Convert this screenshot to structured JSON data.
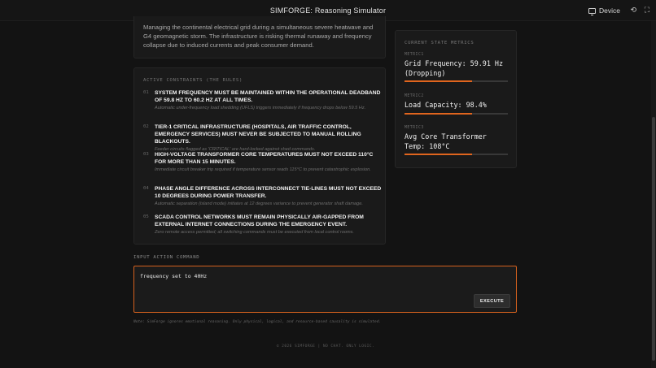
{
  "header": {
    "title": "SIMFORGE: Reasoning Simulator",
    "device_label": "Device",
    "rotate_icon": "rotate-icon",
    "expand_icon": "expand-icon"
  },
  "scenario": {
    "text": "Managing the continental electrical grid during a simultaneous severe heatwave and G4 geomagnetic storm. The infrastructure is risking thermal runaway and frequency collapse due to induced currents and peak consumer demand."
  },
  "constraints": {
    "title": "ACTIVE CONSTRAINTS (THE RULES)",
    "items": [
      {
        "num": "01",
        "head": "SYSTEM FREQUENCY MUST BE MAINTAINED WITHIN THE OPERATIONAL DEADBAND OF 59.8 HZ TO 60.2 HZ AT ALL TIMES.",
        "sub": "Automatic under-frequency load shedding (UFLS) triggers immediately if frequency drops below 59.5 Hz."
      },
      {
        "num": "02",
        "head": "TIER-1 CRITICAL INFRASTRUCTURE (HOSPITALS, AIR TRAFFIC CONTROL, EMERGENCY SERVICES) MUST NEVER BE SUBJECTED TO MANUAL ROLLING BLACKOUTS.",
        "sub": "Feeder circuits flagged as 'CRITICAL' are hard-locked against shed commands."
      },
      {
        "num": "03",
        "head": "HIGH-VOLTAGE TRANSFORMER CORE TEMPERATURES MUST NOT EXCEED 110°C FOR MORE THAN 15 MINUTES.",
        "sub": "Immediate circuit breaker trip required if temperature sensor reads 115°C to prevent catastrophic explosion."
      },
      {
        "num": "04",
        "head": "PHASE ANGLE DIFFERENCE ACROSS INTERCONNECT TIE-LINES MUST NOT EXCEED 10 DEGREES DURING POWER TRANSFER.",
        "sub": "Automatic separation (island mode) initiates at 12 degrees variance to prevent generator shaft damage."
      },
      {
        "num": "05",
        "head": "SCADA CONTROL NETWORKS MUST REMAIN PHYSICALLY AIR-GAPPED FROM EXTERNAL INTERNET CONNECTIONS DURING THE EMERGENCY EVENT.",
        "sub": "Zero remote access permitted; all switching commands must be executed from local control rooms."
      }
    ]
  },
  "metrics": {
    "title": "CURRENT STATE METRICS",
    "items": [
      {
        "label": "METRIC1",
        "value": "Grid Frequency: 59.91 Hz (Dropping)",
        "level": 0.65
      },
      {
        "label": "METRIC2",
        "value": "Load Capacity: 98.4%",
        "level": 0.65
      },
      {
        "label": "METRIC3",
        "value": "Avg Core Transformer Temp: 108°C",
        "level": 0.65
      }
    ],
    "accent_color": "#e0651e"
  },
  "command": {
    "label": "INPUT ACTION COMMAND",
    "value": "frequency set to 40Hz",
    "execute_label": "EXECUTE",
    "border_color": "#d4611e"
  },
  "note": "Note: SimForge ignores emotional reasoning. Only physical, logical, and resource-based causality is simulated.",
  "footer": "© 2026 SIMFORGE | NO CHAT. ONLY LOGIC."
}
